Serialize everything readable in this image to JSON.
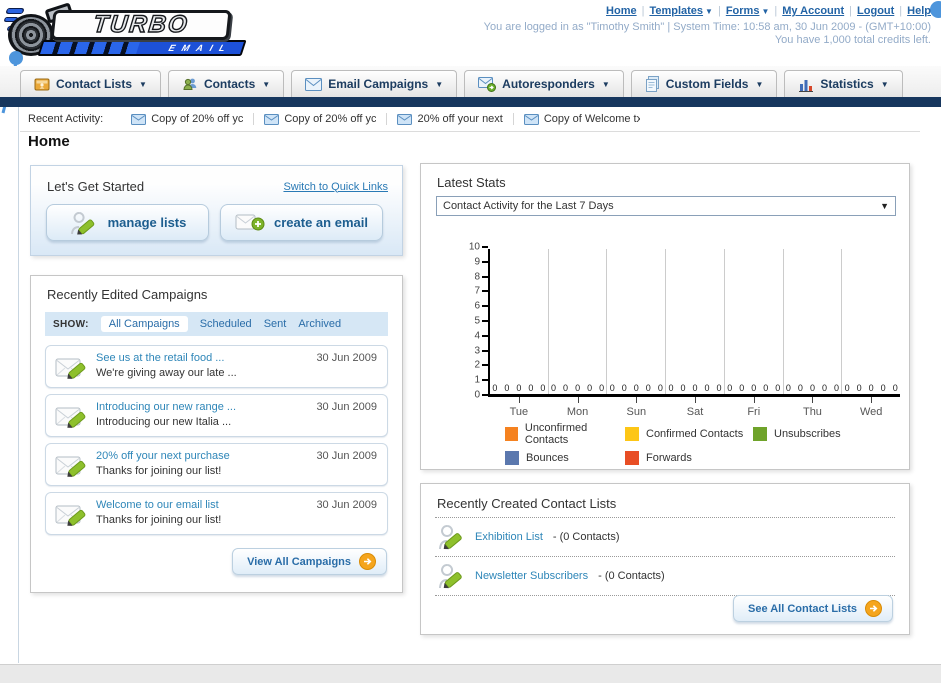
{
  "header": {
    "logo_title": "TURBO",
    "logo_subtitle": "EMAIL",
    "nav": [
      {
        "label": "Home",
        "dropdown": false
      },
      {
        "label": "Templates",
        "dropdown": true
      },
      {
        "label": "Forms",
        "dropdown": true
      },
      {
        "label": "My Account",
        "dropdown": false
      },
      {
        "label": "Logout",
        "dropdown": false
      },
      {
        "label": "Help",
        "dropdown": false
      }
    ],
    "login_info": "You are logged in as \"Timothy Smith\" | System Time: 10:58 am, 30 Jun 2009 - (GMT+10:00)",
    "credits": "You have 1,000 total credits left."
  },
  "tabs": [
    {
      "label": "Contact Lists",
      "icon": "contact-lists-icon"
    },
    {
      "label": "Contacts",
      "icon": "contacts-icon"
    },
    {
      "label": "Email Campaigns",
      "icon": "email-campaigns-icon"
    },
    {
      "label": "Autoresponders",
      "icon": "autoresponders-icon"
    },
    {
      "label": "Custom Fields",
      "icon": "custom-fields-icon"
    },
    {
      "label": "Statistics",
      "icon": "statistics-icon"
    }
  ],
  "recent_activity": {
    "label": "Recent Activity:",
    "items": [
      "Copy of 20% off yc",
      "Copy of 20% off yc",
      "20% off your next ",
      "Copy of Welcome tx"
    ]
  },
  "page_title": "Home",
  "get_started": {
    "title": "Let's Get Started",
    "switch_link": "Switch to Quick Links",
    "buttons": [
      {
        "label": "manage lists",
        "icon": "manage-lists-icon"
      },
      {
        "label": "create an email",
        "icon": "create-email-icon"
      }
    ]
  },
  "campaigns": {
    "title": "Recently Edited Campaigns",
    "show_label": "SHOW:",
    "filters": [
      {
        "label": "All Campaigns",
        "active": true
      },
      {
        "label": "Scheduled",
        "active": false
      },
      {
        "label": "Sent",
        "active": false
      },
      {
        "label": "Archived",
        "active": false
      }
    ],
    "items": [
      {
        "title": "See us at the retail food ...",
        "subtitle": "We're giving away our late ...",
        "date": "30 Jun 2009"
      },
      {
        "title": "Introducing our new range ...",
        "subtitle": "Introducing our new Italia ...",
        "date": "30 Jun 2009"
      },
      {
        "title": "20% off your next purchase",
        "subtitle": "Thanks for joining our list!",
        "date": "30 Jun 2009"
      },
      {
        "title": "Welcome to our email list",
        "subtitle": "Thanks for joining our list!",
        "date": "30 Jun 2009"
      }
    ],
    "view_all_label": "View All Campaigns"
  },
  "stats": {
    "title": "Latest Stats",
    "dropdown_value": "Contact Activity for the Last 7 Days"
  },
  "chart_data": {
    "type": "bar",
    "title": "Contact Activity for the Last 7 Days",
    "categories": [
      "Tue",
      "Mon",
      "Sun",
      "Sat",
      "Fri",
      "Thu",
      "Wed"
    ],
    "series": [
      {
        "name": "Unconfirmed Contacts",
        "color": "#f58220",
        "values": [
          0,
          0,
          0,
          0,
          0,
          0,
          0
        ]
      },
      {
        "name": "Confirmed Contacts",
        "color": "#fdc616",
        "values": [
          0,
          0,
          0,
          0,
          0,
          0,
          0
        ]
      },
      {
        "name": "Unsubscribes",
        "color": "#6fa32a",
        "values": [
          0,
          0,
          0,
          0,
          0,
          0,
          0
        ]
      },
      {
        "name": "Bounces",
        "color": "#5b78ae",
        "values": [
          0,
          0,
          0,
          0,
          0,
          0,
          0
        ]
      },
      {
        "name": "Forwards",
        "color": "#e84e25",
        "values": [
          0,
          0,
          0,
          0,
          0,
          0,
          0
        ]
      }
    ],
    "ylim": [
      0,
      10
    ],
    "yticks": [
      0,
      1,
      2,
      3,
      4,
      5,
      6,
      7,
      8,
      9,
      10
    ],
    "grid": "vertical",
    "legend_position": "bottom"
  },
  "contact_lists": {
    "title": "Recently Created Contact Lists",
    "items": [
      {
        "name": "Exhibition List",
        "count": "- (0 Contacts)"
      },
      {
        "name": "Newsletter Subscribers",
        "count": "- (0 Contacts)"
      }
    ],
    "see_all_label": "See All Contact Lists"
  }
}
